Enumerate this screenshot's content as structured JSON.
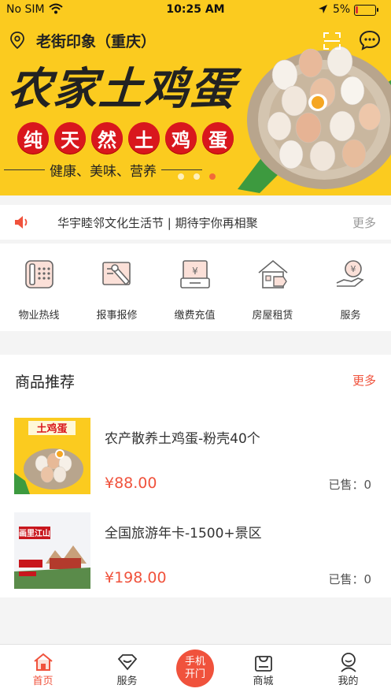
{
  "status_bar": {
    "carrier": "No SIM",
    "time": "10:25 AM",
    "battery": "5%"
  },
  "banner": {
    "location": "老街印象（重庆）",
    "title": "农家土鸡蛋",
    "red_chars": [
      "纯",
      "天",
      "然",
      "土",
      "鸡",
      "蛋"
    ],
    "tagline": "健康、美味、营养",
    "slide_count": 3,
    "active_slide": 3
  },
  "notice": {
    "text": "华宇睦邻文化生活节 | 期待宇你再相聚",
    "more": "更多"
  },
  "services": [
    {
      "label": "物业热线",
      "icon": "phone-icon"
    },
    {
      "label": "报事报修",
      "icon": "repair-icon"
    },
    {
      "label": "缴费充值",
      "icon": "payment-icon"
    },
    {
      "label": "房屋租赁",
      "icon": "house-rent-icon"
    },
    {
      "label": "服务",
      "icon": "service-icon"
    }
  ],
  "products": {
    "heading": "商品推荐",
    "more": "更多",
    "items": [
      {
        "name": "农产散养土鸡蛋-粉壳40个",
        "price": "¥88.00",
        "sold": "已售：0",
        "thumb_text": "土鸡蛋"
      },
      {
        "name": "全国旅游年卡-1500+景区",
        "price": "¥198.00",
        "sold": "已售：0",
        "thumb_text": "画里江山"
      }
    ]
  },
  "tabbar": {
    "tabs": [
      {
        "label": "首页",
        "icon": "home-icon",
        "active": true
      },
      {
        "label": "服务",
        "icon": "service-tab-icon",
        "active": false
      },
      {
        "label": "商城",
        "icon": "shop-icon",
        "active": false
      },
      {
        "label": "我的",
        "icon": "profile-icon",
        "active": false
      }
    ],
    "center_button": {
      "line1": "手机",
      "line2": "开门"
    }
  },
  "colors": {
    "accent": "#f0523c",
    "banner_bg": "#fbcb1f",
    "badge_red": "#d9171d"
  }
}
